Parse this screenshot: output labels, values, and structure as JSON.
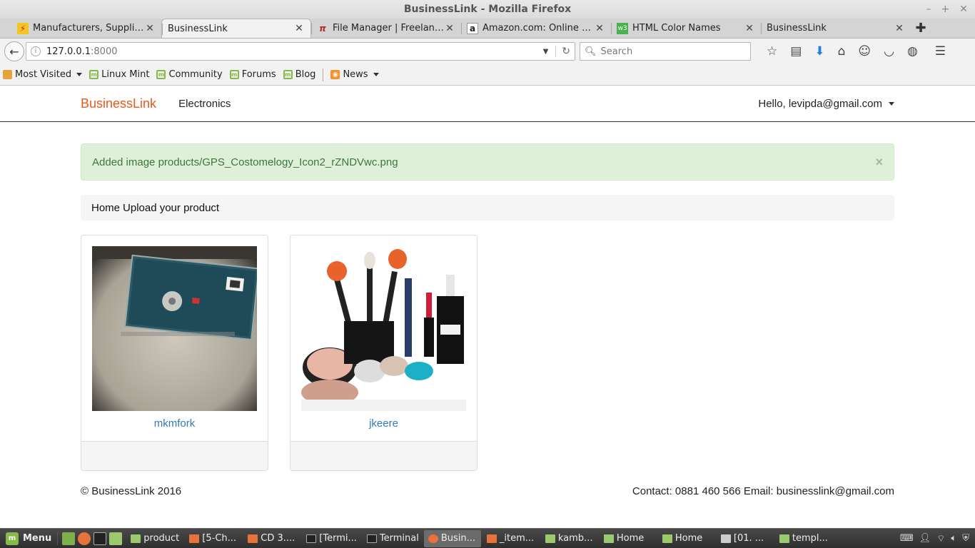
{
  "window": {
    "title": "BusinessLink - Mozilla Firefox",
    "controls": [
      "–",
      "+",
      "✕"
    ]
  },
  "tabs": [
    {
      "label": "Manufacturers, Supplie...",
      "icon": "manufacturers-favicon",
      "active": false
    },
    {
      "label": "BusinessLink",
      "icon": "blank-favicon",
      "active": true
    },
    {
      "label": "File Manager | Freelanc...",
      "icon": "pi-favicon",
      "active": false
    },
    {
      "label": "Amazon.com: Online S...",
      "icon": "amazon-favicon",
      "active": false
    },
    {
      "label": "HTML Color Names",
      "icon": "w3-favicon",
      "active": false
    },
    {
      "label": "BusinessLink",
      "icon": "blank-favicon",
      "active": false
    }
  ],
  "toolbar": {
    "url_host": "127.0.0.1",
    "url_port": ":8000",
    "search_placeholder": "Search"
  },
  "bookmarks": [
    {
      "label": "Most Visited",
      "icon": "folder-icon",
      "dropdown": true
    },
    {
      "label": "Linux Mint",
      "icon": "mint-icon"
    },
    {
      "label": "Community",
      "icon": "mint-icon"
    },
    {
      "label": "Forums",
      "icon": "mint-icon"
    },
    {
      "label": "Blog",
      "icon": "mint-icon"
    },
    {
      "label": "News",
      "icon": "rss-icon",
      "dropdown": true
    }
  ],
  "site": {
    "brand": "BusinessLink",
    "nav_link": "Electronics",
    "user_greeting": "Hello, levipda@gmail.com",
    "brand_color": "#e8581b"
  },
  "alert": {
    "message": "Added image products/GPS_Costomelogy_Icon2_rZNDVwc.png",
    "close": "×"
  },
  "breadcrumb": {
    "home": "Home",
    "current": "Upload your product"
  },
  "products": [
    {
      "name": "mkmfork",
      "image": "hard-drive-photo"
    },
    {
      "name": "jkeere",
      "image": "makeup-brushes-photo"
    }
  ],
  "footer": {
    "copyright": "© BusinessLink 2016",
    "contact": "Contact: 0881 460 566 Email: businesslink@gmail.com"
  },
  "taskbar": {
    "menu_label": "Menu",
    "items": [
      {
        "label": "product",
        "icon": "folder"
      },
      {
        "label": "[5-Ch...",
        "icon": "doc"
      },
      {
        "label": "CD 3....",
        "icon": "doc"
      },
      {
        "label": "[Termi...",
        "icon": "term"
      },
      {
        "label": "Terminal",
        "icon": "term"
      },
      {
        "label": "Busin...",
        "icon": "ff",
        "active": true
      },
      {
        "label": "_item...",
        "icon": "doc"
      },
      {
        "label": "kamb...",
        "icon": "folder"
      },
      {
        "label": "Home",
        "icon": "folder"
      },
      {
        "label": "Home",
        "icon": "folder"
      },
      {
        "label": "[01. ...",
        "icon": "video"
      },
      {
        "label": "templ...",
        "icon": "folder"
      }
    ]
  }
}
